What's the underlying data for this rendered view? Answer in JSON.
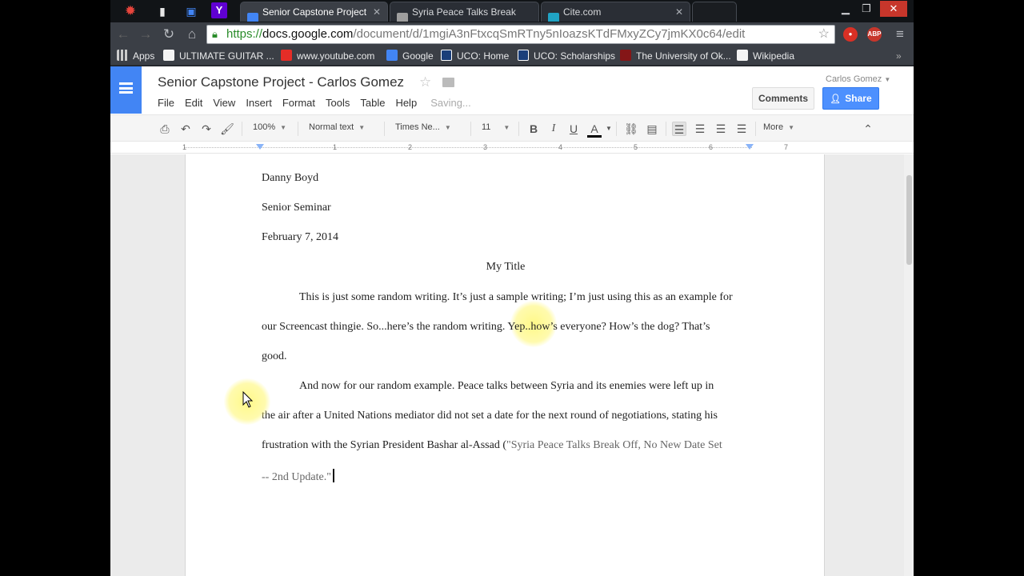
{
  "browser": {
    "tabs": [
      {
        "label": "Senior Capstone Project -",
        "color": "#4285f4"
      },
      {
        "label": "Syria Peace Talks Break Of",
        "color": "#9e9e9e"
      },
      {
        "label": "Cite.com",
        "color": "#20a3c4"
      }
    ],
    "url": {
      "scheme": "https://",
      "host": "docs.google.com",
      "path": "/document/d/1mgiA3nFtxcqSmRTny5nIoazsKTdFMxyZCy7jmKX0c64/edit"
    },
    "bookmarks": [
      {
        "label": "Apps",
        "color": "#e0e0e0"
      },
      {
        "label": "ULTIMATE GUITAR ...",
        "color": "#f4f4f4"
      },
      {
        "label": "www.youtube.com",
        "color": "#e52d27"
      },
      {
        "label": "Google",
        "color": "#4285f4"
      },
      {
        "label": "UCO: Home",
        "color": "#1b3f7a"
      },
      {
        "label": "UCO: Scholarships",
        "color": "#1b3f7a"
      },
      {
        "label": "The University of Ok...",
        "color": "#841617"
      },
      {
        "label": "Wikipedia",
        "color": "#f4f4f4"
      }
    ],
    "extensions": [
      {
        "label": "",
        "color": "#d93025"
      },
      {
        "label": "ABP",
        "color": "#c7362b"
      }
    ]
  },
  "docs": {
    "title": "Senior Capstone Project - Carlos Gomez",
    "menus": [
      "File",
      "Edit",
      "View",
      "Insert",
      "Format",
      "Tools",
      "Table",
      "Help"
    ],
    "saving_status": "Saving...",
    "user_name": "Carlos Gomez",
    "comments_label": "Comments",
    "share_label": "Share",
    "toolbar": {
      "zoom": "100%",
      "style": "Normal text",
      "font": "Times Ne...",
      "size": "11",
      "bold": "B",
      "italic": "I",
      "underline": "U",
      "text_color": "A",
      "more": "More"
    },
    "ruler_numbers": [
      "1",
      "1",
      "2",
      "3",
      "4",
      "5",
      "6",
      "7"
    ]
  },
  "document": {
    "author": "Danny Boyd",
    "course": "Senior Seminar",
    "date": "February 7, 2014",
    "title": "My Title",
    "p1_line1": "This is just some random writing. It’s just a sample writing; I’m just using this as an example for",
    "p1_line2": "our Screencast thingie. So...here’s the random writing. Yep..how’s everyone? How’s the dog? That’s",
    "p1_line3": "good.",
    "p2_line1": "And now for our random example. Peace talks between Syria and its enemies were left up in",
    "p2_line2": "the air after a United Nations mediator did not set a date for the next round of negotiations, stating his",
    "p2_line3_text": "frustration with the Syrian President Bashar al-Assad (",
    "p2_line3_cite": "\"Syria Peace Talks Break Off, No New Date Set",
    "p2_line4_cite": "-- 2nd Update.\""
  }
}
